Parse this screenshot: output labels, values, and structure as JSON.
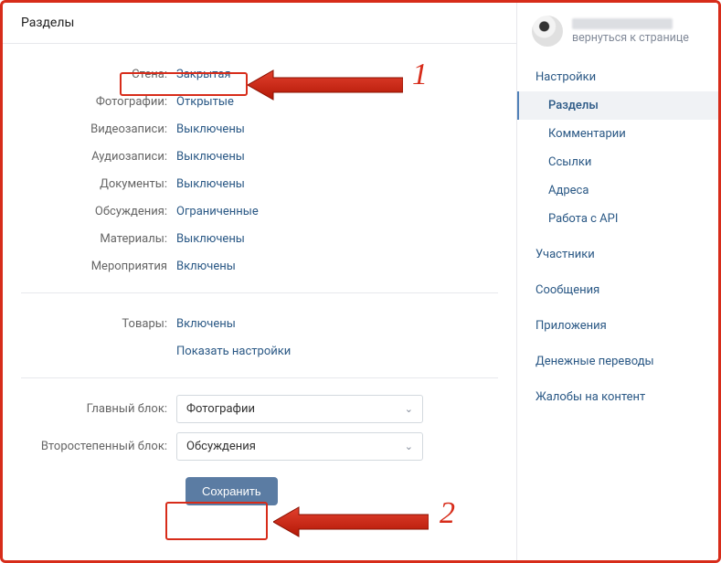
{
  "header": {
    "title": "Разделы"
  },
  "settings": [
    {
      "label": "Стена:",
      "value": "Закрытая"
    },
    {
      "label": "Фотографии:",
      "value": "Открытые"
    },
    {
      "label": "Видеозаписи:",
      "value": "Выключены"
    },
    {
      "label": "Аудиозаписи:",
      "value": "Выключены"
    },
    {
      "label": "Документы:",
      "value": "Выключены"
    },
    {
      "label": "Обсуждения:",
      "value": "Ограниченные"
    },
    {
      "label": "Материалы:",
      "value": "Выключены"
    },
    {
      "label": "Мероприятия",
      "value": "Включены"
    }
  ],
  "goods": {
    "label": "Товары:",
    "value": "Включены",
    "show_settings": "Показать настройки"
  },
  "blocks": {
    "main": {
      "label": "Главный блок:",
      "selected": "Фотографии"
    },
    "secondary": {
      "label": "Второстепенный блок:",
      "selected": "Обсуждения"
    }
  },
  "save_button": "Сохранить",
  "profile": {
    "back_text": "вернуться к странице"
  },
  "sidebar": {
    "items": [
      {
        "label": "Настройки",
        "sub": false,
        "active": false
      },
      {
        "label": "Разделы",
        "sub": true,
        "active": true
      },
      {
        "label": "Комментарии",
        "sub": true,
        "active": false
      },
      {
        "label": "Ссылки",
        "sub": true,
        "active": false
      },
      {
        "label": "Адреса",
        "sub": true,
        "active": false
      },
      {
        "label": "Работа с API",
        "sub": true,
        "active": false
      },
      {
        "label": "Участники",
        "sub": false,
        "active": false
      },
      {
        "label": "Сообщения",
        "sub": false,
        "active": false
      },
      {
        "label": "Приложения",
        "sub": false,
        "active": false
      },
      {
        "label": "Денежные переводы",
        "sub": false,
        "active": false
      },
      {
        "label": "Жалобы на контент",
        "sub": false,
        "active": false
      }
    ]
  },
  "annotations": {
    "num1": "1",
    "num2": "2"
  }
}
